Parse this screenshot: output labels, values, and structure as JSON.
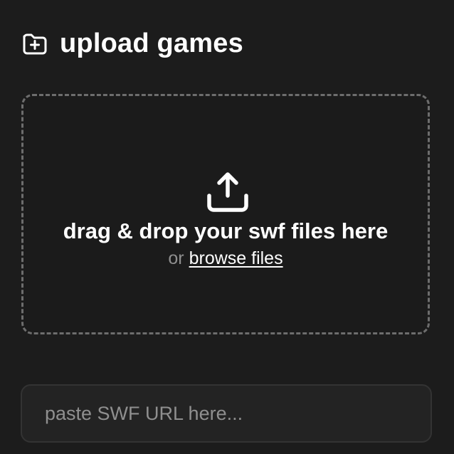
{
  "header": {
    "title": "upload games",
    "icon": "folder-plus-icon"
  },
  "dropzone": {
    "icon": "upload-icon",
    "title": "drag & drop your swf files here",
    "or_text": "or",
    "browse_label": "browse files"
  },
  "url_input": {
    "placeholder": "paste SWF URL here...",
    "value": ""
  },
  "colors": {
    "background": "#1c1c1c",
    "text": "#ffffff",
    "muted_text": "#8f8f8f",
    "dashed_border": "#6d6d6d",
    "input_background": "#232323",
    "input_border": "#333333"
  }
}
